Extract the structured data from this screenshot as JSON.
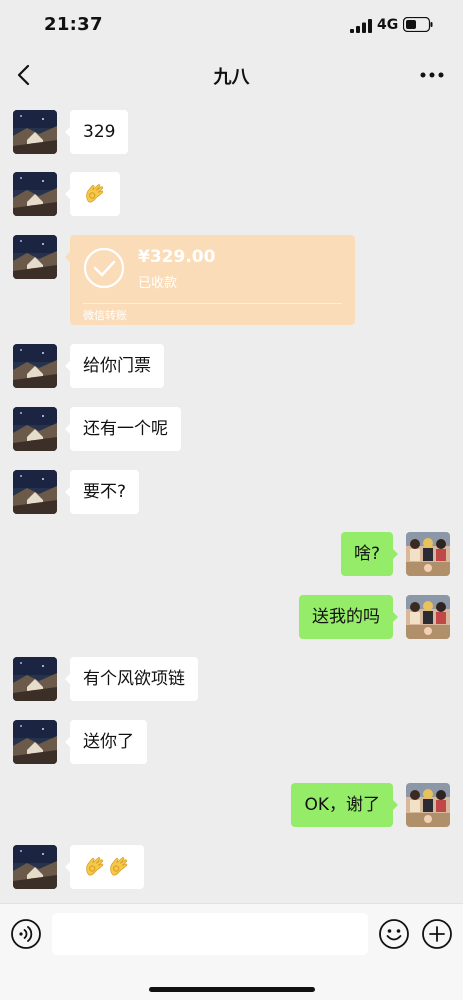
{
  "status_bar": {
    "time": "21:37",
    "network": "4G",
    "icons": [
      "signal-icon",
      "battery-icon"
    ]
  },
  "nav": {
    "title": "九八",
    "icons": [
      "back-icon",
      "more-icon"
    ]
  },
  "avatars": {
    "contact": "contact-avatar (night scene)",
    "self": "self-avatar (group photo)"
  },
  "messages": [
    {
      "side": "left",
      "type": "text",
      "text": "329"
    },
    {
      "side": "left",
      "type": "emoji",
      "emoji": "ok-hand-emoji",
      "count": 1
    },
    {
      "side": "left",
      "type": "transfer",
      "amount": "¥329.00",
      "status": "已收款",
      "footer": "微信转账"
    },
    {
      "side": "left",
      "type": "text",
      "text": "给你门票"
    },
    {
      "side": "left",
      "type": "text",
      "text": "还有一个呢"
    },
    {
      "side": "left",
      "type": "text",
      "text": "要不?"
    },
    {
      "side": "right",
      "type": "text",
      "text": "啥?"
    },
    {
      "side": "right",
      "type": "text",
      "text": "送我的吗"
    },
    {
      "side": "left",
      "type": "text",
      "text": "有个风欲项链"
    },
    {
      "side": "left",
      "type": "text",
      "text": "送你了"
    },
    {
      "side": "right",
      "type": "text",
      "text": "OK，谢了"
    },
    {
      "side": "left",
      "type": "emoji",
      "emoji": "ok-hand-emoji",
      "count": 2
    }
  ],
  "input_bar": {
    "input_value": "",
    "icons": [
      "voice-icon",
      "emoji-face-icon",
      "plus-icon"
    ]
  },
  "colors": {
    "background": "#ededed",
    "bubble_left": "#ffffff",
    "bubble_right": "#95ec69",
    "transfer_card": "#fbdcb9"
  }
}
